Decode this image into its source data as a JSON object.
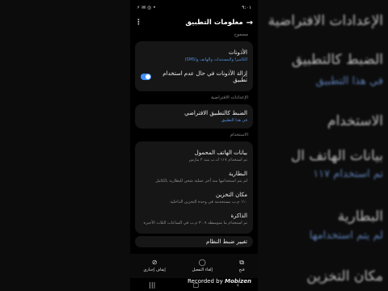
{
  "status_bar": {
    "time": "٩:٠١",
    "left_icons": "⚡ ✉ ◎ •"
  },
  "header": {
    "title": "معلومات التطبيق"
  },
  "notifications_section": {
    "label": "مسموح",
    "title": "الأذونات",
    "subtitle": "الكاميرا والمستندات والهاتف و(SMS)",
    "remove_permissions": "إزالة الأذونات في حال عدم استخدام تطبيق",
    "toggle_on": true
  },
  "defaults_section": {
    "label": "الإعدادات الافتراضية",
    "title": "الضبط كالتطبيق الافتراضي",
    "subtitle": "في هذا التطبيق"
  },
  "usage_section": {
    "label": "الاستخدام",
    "items": [
      {
        "title": "بيانات الهاتف المحمول",
        "subtitle": "تم استخدام ١١٧ ك.ب منذ ٢ مارس"
      },
      {
        "title": "البطارية",
        "subtitle": "لم يتم استخدامها منذ آخر عملية شحن للبطارية بالكامل"
      },
      {
        "title": "مكان التخزين",
        "subtitle": "١١٠ م.ب مستخدمة في وحدة التخزين الداخلية"
      },
      {
        "title": "الذاكرة",
        "subtitle": "تم استخدام ما متوسطه ٣٠.٩ م.ب في الساعات الثلاث الأخيرة"
      }
    ],
    "last_item": "تغيير ضبط النظام"
  },
  "bottom_actions": [
    {
      "icon": "open-icon",
      "glyph": "⧉",
      "label": "فتح"
    },
    {
      "icon": "disable-icon",
      "glyph": "◯",
      "label": "إلغاء التفعيل"
    },
    {
      "icon": "force-stop-icon",
      "glyph": "⊘",
      "label": "إيقاف إجباري"
    }
  ],
  "watermark": {
    "prefix": "Recorded by",
    "brand": "Mobizen"
  },
  "background": {
    "lines": [
      "الإعدادات الافتراضية",
      "الضبط كالتطبيق",
      "في هذا التطبيق",
      "الاستخدام",
      "بيانات الهاتف ال",
      "تم استخدام ١١٧",
      "البطارية",
      "لم يتم استخدامها",
      "مكان التخزين"
    ]
  }
}
